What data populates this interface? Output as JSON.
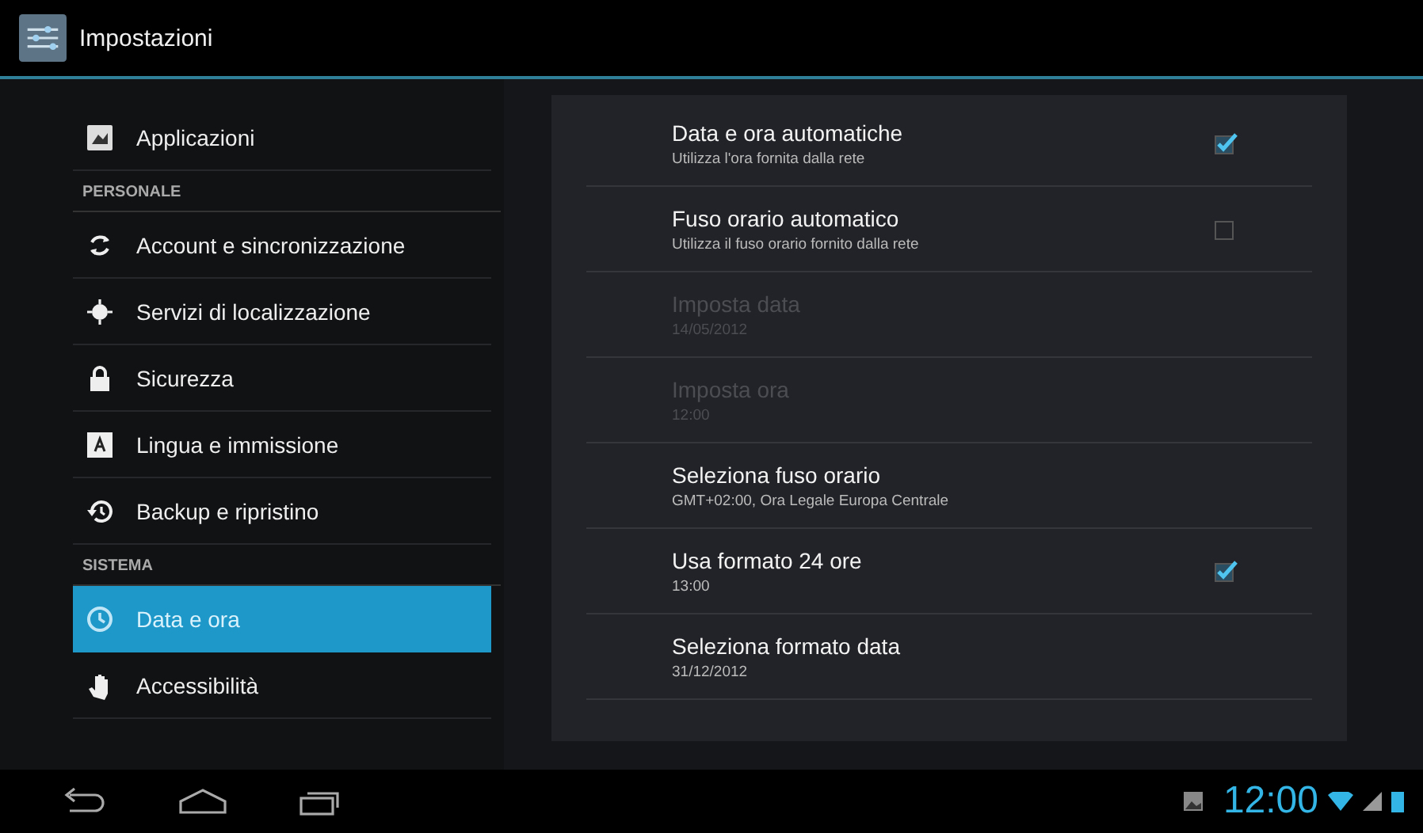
{
  "action_bar": {
    "title": "Impostazioni"
  },
  "sidebar": {
    "items": [
      {
        "kind": "item",
        "label": "Applicazioni",
        "selected": false
      },
      {
        "kind": "header",
        "label": "PERSONALE"
      },
      {
        "kind": "item",
        "label": "Account e sincronizzazione",
        "selected": false
      },
      {
        "kind": "item",
        "label": "Servizi di localizzazione",
        "selected": false
      },
      {
        "kind": "item",
        "label": "Sicurezza",
        "selected": false
      },
      {
        "kind": "item",
        "label": "Lingua e immissione",
        "selected": false
      },
      {
        "kind": "item",
        "label": "Backup e ripristino",
        "selected": false
      },
      {
        "kind": "header",
        "label": "SISTEMA"
      },
      {
        "kind": "item",
        "label": "Data e ora",
        "selected": true
      },
      {
        "kind": "item",
        "label": "Accessibilità",
        "selected": false
      }
    ]
  },
  "settings": [
    {
      "kind": "checkbox",
      "title": "Data e ora automatiche",
      "summary": "Utilizza l'ora fornita dalla rete",
      "checked": true,
      "disabled": false
    },
    {
      "kind": "checkbox",
      "title": "Fuso orario automatico",
      "summary": "Utilizza il fuso orario fornito dalla rete",
      "checked": false,
      "disabled": false
    },
    {
      "kind": "plain",
      "title": "Imposta data",
      "summary": "14/05/2012",
      "disabled": true
    },
    {
      "kind": "plain",
      "title": "Imposta ora",
      "summary": "12:00",
      "disabled": true
    },
    {
      "kind": "plain",
      "title": "Seleziona fuso orario",
      "summary": "GMT+02:00, Ora Legale Europa Centrale",
      "disabled": false
    },
    {
      "kind": "checkbox",
      "title": "Usa formato 24 ore",
      "summary": "13:00",
      "checked": true,
      "disabled": false
    },
    {
      "kind": "plain",
      "title": "Seleziona formato data",
      "summary": "31/12/2012",
      "disabled": false
    }
  ],
  "status_bar": {
    "time": "12:00"
  }
}
